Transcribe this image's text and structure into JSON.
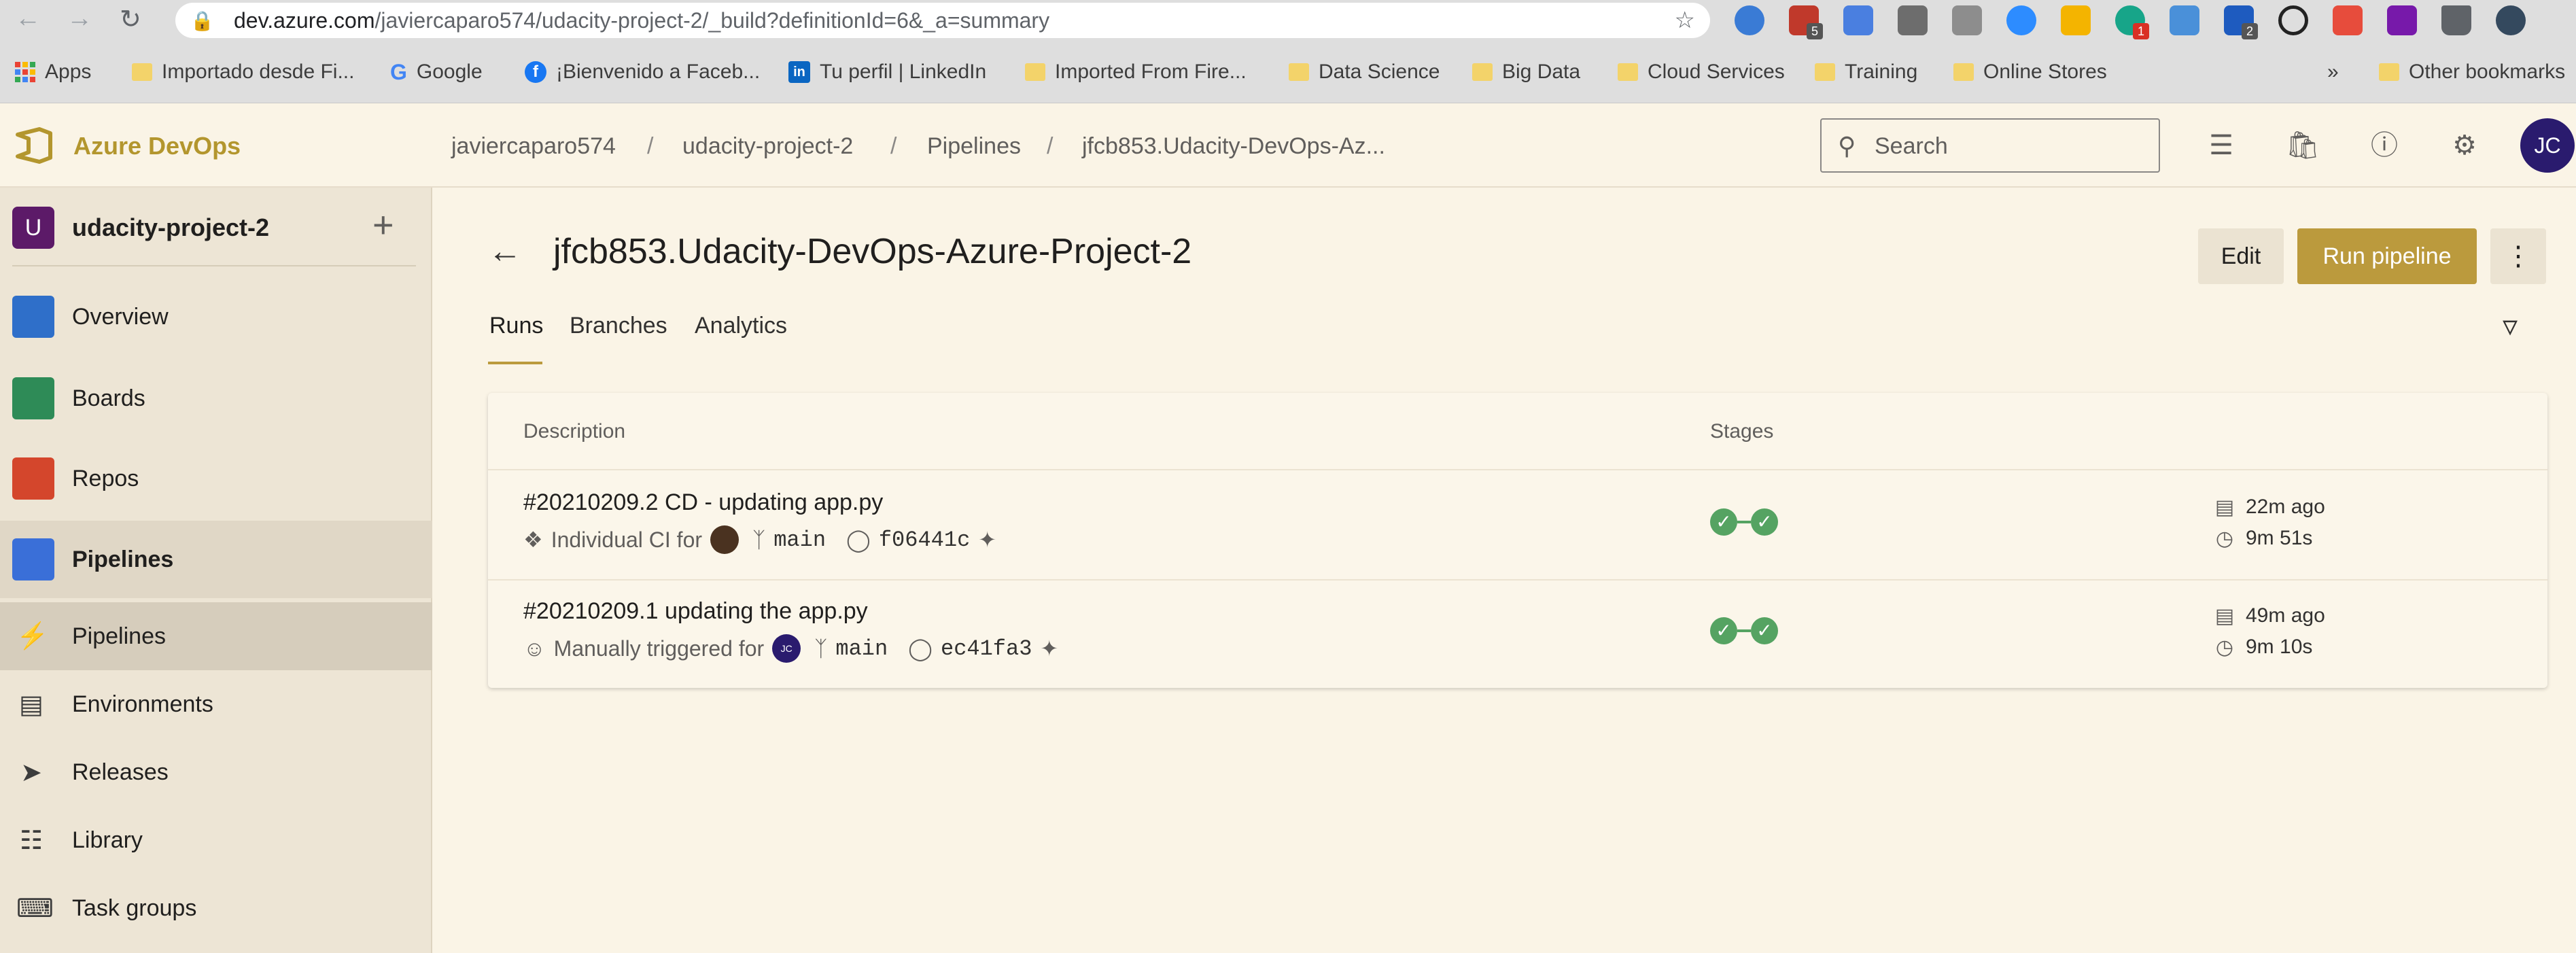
{
  "browser": {
    "url_host": "dev.azure.com",
    "url_path": "/javiercaparo574/udacity-project-2/_build?definitionId=6&_a=summary",
    "bookmarks": [
      {
        "label": "Apps",
        "icon": "apps-grid-icon"
      },
      {
        "label": "Importado desde Fi...",
        "icon": "folder-icon"
      },
      {
        "label": "Google",
        "icon": "google-icon"
      },
      {
        "label": "¡Bienvenido a Faceb...",
        "icon": "facebook-icon"
      },
      {
        "label": "Tu perfil | LinkedIn",
        "icon": "linkedin-icon"
      },
      {
        "label": "Imported From Fire...",
        "icon": "folder-icon"
      },
      {
        "label": "Data Science",
        "icon": "folder-icon"
      },
      {
        "label": "Big Data",
        "icon": "folder-icon"
      },
      {
        "label": "Cloud Services",
        "icon": "folder-icon"
      },
      {
        "label": "Training",
        "icon": "folder-icon"
      },
      {
        "label": "Online Stores",
        "icon": "folder-icon"
      }
    ],
    "overflow": "»",
    "other_bookmarks": "Other bookmarks",
    "extension_badges": {
      "ext2": "5",
      "ext7": "1",
      "ext10": "2"
    }
  },
  "header": {
    "brand": "Azure DevOps",
    "breadcrumbs": [
      "javiercaparo574",
      "udacity-project-2",
      "Pipelines",
      "jfcb853.Udacity-DevOps-Az..."
    ],
    "separator": "/",
    "search_placeholder": "Search",
    "avatar_initials": "JC"
  },
  "sidebar": {
    "project_initial": "U",
    "project_name": "udacity-project-2",
    "add": "+",
    "items": [
      {
        "label": "Overview",
        "icon": "overview-icon"
      },
      {
        "label": "Boards",
        "icon": "boards-icon"
      },
      {
        "label": "Repos",
        "icon": "repos-icon"
      },
      {
        "label": "Pipelines",
        "icon": "pipelines-icon"
      }
    ],
    "sub_items": [
      {
        "label": "Pipelines",
        "icon": "pipelines-sub-icon"
      },
      {
        "label": "Environments",
        "icon": "environments-icon"
      },
      {
        "label": "Releases",
        "icon": "releases-icon"
      },
      {
        "label": "Library",
        "icon": "library-icon"
      },
      {
        "label": "Task groups",
        "icon": "task-groups-icon"
      }
    ]
  },
  "main": {
    "title": "jfcb853.Udacity-DevOps-Azure-Project-2",
    "edit_label": "Edit",
    "run_label": "Run pipeline",
    "tabs": [
      "Runs",
      "Branches",
      "Analytics"
    ],
    "columns": {
      "description": "Description",
      "stages": "Stages"
    },
    "runs": [
      {
        "title": "#20210209.2 CD - updating app.py",
        "trigger": "Individual CI for",
        "branch": "main",
        "commit": "f06441c",
        "age": "22m ago",
        "duration": "9m 51s"
      },
      {
        "title": "#20210209.1 updating the app.py",
        "trigger": "Manually triggered for",
        "trigger_avatar": "JC",
        "branch": "main",
        "commit": "ec41fa3",
        "age": "49m ago",
        "duration": "9m 10s"
      }
    ]
  },
  "colors": {
    "accent": "#bb9a3d",
    "brand": "#b3962e",
    "success": "#55a362",
    "avatar": "#2a1b6e",
    "project": "#5c1a68"
  }
}
